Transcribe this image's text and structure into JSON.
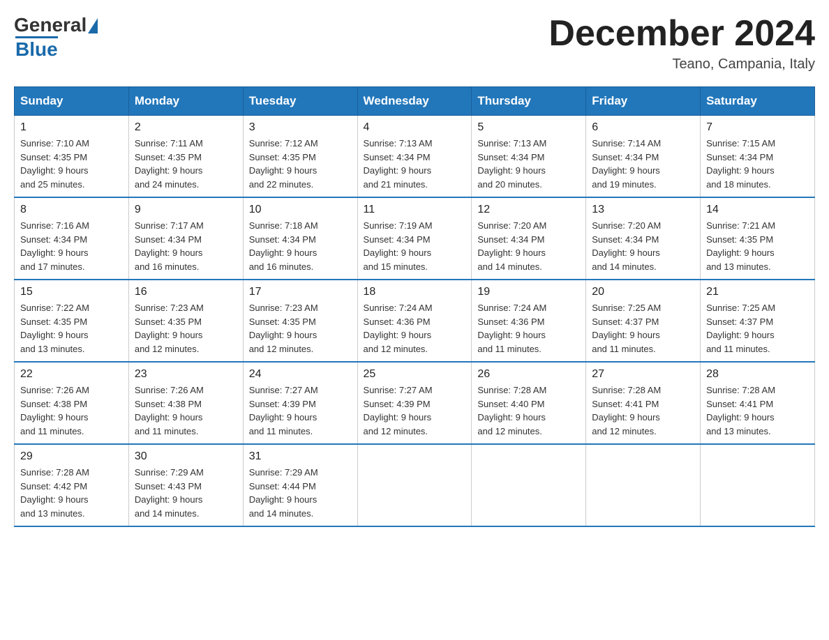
{
  "logo": {
    "general": "General",
    "blue": "Blue"
  },
  "title": {
    "month": "December 2024",
    "location": "Teano, Campania, Italy"
  },
  "weekdays": [
    "Sunday",
    "Monday",
    "Tuesday",
    "Wednesday",
    "Thursday",
    "Friday",
    "Saturday"
  ],
  "weeks": [
    [
      {
        "day": "1",
        "sunrise": "7:10 AM",
        "sunset": "4:35 PM",
        "daylight": "9 hours and 25 minutes."
      },
      {
        "day": "2",
        "sunrise": "7:11 AM",
        "sunset": "4:35 PM",
        "daylight": "9 hours and 24 minutes."
      },
      {
        "day": "3",
        "sunrise": "7:12 AM",
        "sunset": "4:35 PM",
        "daylight": "9 hours and 22 minutes."
      },
      {
        "day": "4",
        "sunrise": "7:13 AM",
        "sunset": "4:34 PM",
        "daylight": "9 hours and 21 minutes."
      },
      {
        "day": "5",
        "sunrise": "7:13 AM",
        "sunset": "4:34 PM",
        "daylight": "9 hours and 20 minutes."
      },
      {
        "day": "6",
        "sunrise": "7:14 AM",
        "sunset": "4:34 PM",
        "daylight": "9 hours and 19 minutes."
      },
      {
        "day": "7",
        "sunrise": "7:15 AM",
        "sunset": "4:34 PM",
        "daylight": "9 hours and 18 minutes."
      }
    ],
    [
      {
        "day": "8",
        "sunrise": "7:16 AM",
        "sunset": "4:34 PM",
        "daylight": "9 hours and 17 minutes."
      },
      {
        "day": "9",
        "sunrise": "7:17 AM",
        "sunset": "4:34 PM",
        "daylight": "9 hours and 16 minutes."
      },
      {
        "day": "10",
        "sunrise": "7:18 AM",
        "sunset": "4:34 PM",
        "daylight": "9 hours and 16 minutes."
      },
      {
        "day": "11",
        "sunrise": "7:19 AM",
        "sunset": "4:34 PM",
        "daylight": "9 hours and 15 minutes."
      },
      {
        "day": "12",
        "sunrise": "7:20 AM",
        "sunset": "4:34 PM",
        "daylight": "9 hours and 14 minutes."
      },
      {
        "day": "13",
        "sunrise": "7:20 AM",
        "sunset": "4:34 PM",
        "daylight": "9 hours and 14 minutes."
      },
      {
        "day": "14",
        "sunrise": "7:21 AM",
        "sunset": "4:35 PM",
        "daylight": "9 hours and 13 minutes."
      }
    ],
    [
      {
        "day": "15",
        "sunrise": "7:22 AM",
        "sunset": "4:35 PM",
        "daylight": "9 hours and 13 minutes."
      },
      {
        "day": "16",
        "sunrise": "7:23 AM",
        "sunset": "4:35 PM",
        "daylight": "9 hours and 12 minutes."
      },
      {
        "day": "17",
        "sunrise": "7:23 AM",
        "sunset": "4:35 PM",
        "daylight": "9 hours and 12 minutes."
      },
      {
        "day": "18",
        "sunrise": "7:24 AM",
        "sunset": "4:36 PM",
        "daylight": "9 hours and 12 minutes."
      },
      {
        "day": "19",
        "sunrise": "7:24 AM",
        "sunset": "4:36 PM",
        "daylight": "9 hours and 11 minutes."
      },
      {
        "day": "20",
        "sunrise": "7:25 AM",
        "sunset": "4:37 PM",
        "daylight": "9 hours and 11 minutes."
      },
      {
        "day": "21",
        "sunrise": "7:25 AM",
        "sunset": "4:37 PM",
        "daylight": "9 hours and 11 minutes."
      }
    ],
    [
      {
        "day": "22",
        "sunrise": "7:26 AM",
        "sunset": "4:38 PM",
        "daylight": "9 hours and 11 minutes."
      },
      {
        "day": "23",
        "sunrise": "7:26 AM",
        "sunset": "4:38 PM",
        "daylight": "9 hours and 11 minutes."
      },
      {
        "day": "24",
        "sunrise": "7:27 AM",
        "sunset": "4:39 PM",
        "daylight": "9 hours and 11 minutes."
      },
      {
        "day": "25",
        "sunrise": "7:27 AM",
        "sunset": "4:39 PM",
        "daylight": "9 hours and 12 minutes."
      },
      {
        "day": "26",
        "sunrise": "7:28 AM",
        "sunset": "4:40 PM",
        "daylight": "9 hours and 12 minutes."
      },
      {
        "day": "27",
        "sunrise": "7:28 AM",
        "sunset": "4:41 PM",
        "daylight": "9 hours and 12 minutes."
      },
      {
        "day": "28",
        "sunrise": "7:28 AM",
        "sunset": "4:41 PM",
        "daylight": "9 hours and 13 minutes."
      }
    ],
    [
      {
        "day": "29",
        "sunrise": "7:28 AM",
        "sunset": "4:42 PM",
        "daylight": "9 hours and 13 minutes."
      },
      {
        "day": "30",
        "sunrise": "7:29 AM",
        "sunset": "4:43 PM",
        "daylight": "9 hours and 14 minutes."
      },
      {
        "day": "31",
        "sunrise": "7:29 AM",
        "sunset": "4:44 PM",
        "daylight": "9 hours and 14 minutes."
      },
      null,
      null,
      null,
      null
    ]
  ],
  "labels": {
    "sunrise": "Sunrise:",
    "sunset": "Sunset:",
    "daylight": "Daylight: 9 hours"
  }
}
